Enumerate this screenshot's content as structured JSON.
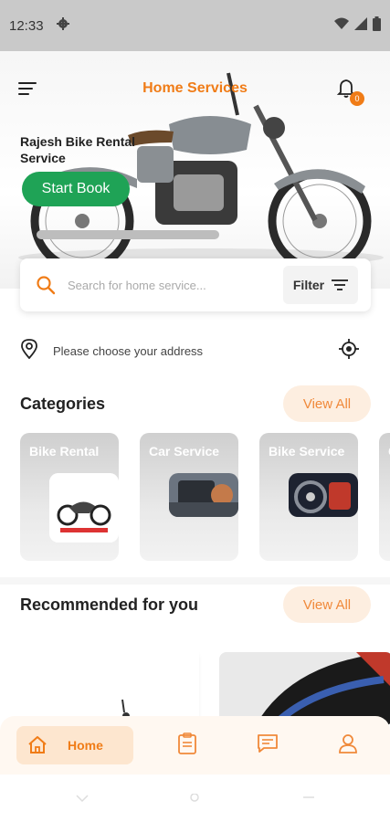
{
  "status_bar": {
    "time": "12:33",
    "icons": [
      "gear-icon",
      "wifi-icon",
      "signal-icon",
      "battery-icon"
    ]
  },
  "app_bar": {
    "title": "Home Services",
    "notification_count": "0",
    "menu_icon": "menu-icon",
    "bell_icon": "bell-icon"
  },
  "banner": {
    "title": "Rajesh Bike Rental Service",
    "cta_label": "Start Book"
  },
  "search": {
    "placeholder": "Search for home service...",
    "filter_label": "Filter"
  },
  "address": {
    "text": "Please choose your address"
  },
  "categories": {
    "title": "Categories",
    "view_all_label": "View All",
    "items": [
      {
        "label": "Bike Rental"
      },
      {
        "label": "Car Service"
      },
      {
        "label": "Bike Service"
      },
      {
        "label": "C"
      }
    ]
  },
  "recommended": {
    "title": "Recommended for you",
    "view_all_label": "View All"
  },
  "bottom_nav": {
    "home_label": "Home",
    "items": [
      "home-icon",
      "bookings-icon",
      "chat-icon",
      "profile-icon"
    ]
  },
  "colors": {
    "accent": "#f07c17",
    "accent_light": "#fdeee0",
    "cta_green": "#1fa356"
  }
}
